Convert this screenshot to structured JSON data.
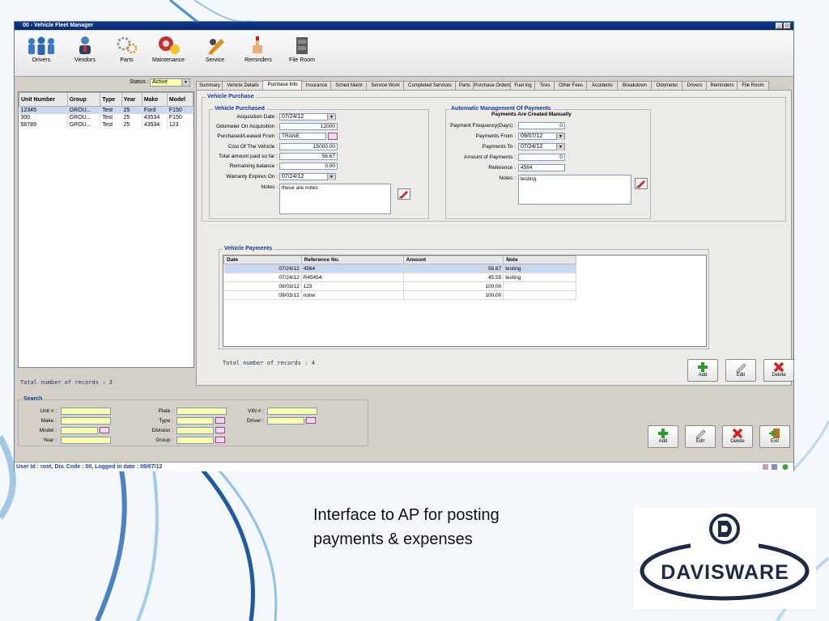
{
  "window": {
    "title": "00 - Vehicle Fleet Manager"
  },
  "toolbar": [
    {
      "label": "Drivers",
      "icon": "drivers-icon"
    },
    {
      "label": "Vendors",
      "icon": "vendors-icon"
    },
    {
      "label": "Parts",
      "icon": "parts-icon"
    },
    {
      "label": "Maintenance",
      "icon": "maintenance-icon"
    },
    {
      "label": "Service",
      "icon": "service-icon"
    },
    {
      "label": "Reminders",
      "icon": "reminders-icon"
    },
    {
      "label": "File Room",
      "icon": "file-room-icon"
    }
  ],
  "left": {
    "status_label": "Status :",
    "status_value": "Active",
    "columns": [
      "Unit Number",
      "Group",
      "Type",
      "Year",
      "Make",
      "Model"
    ],
    "rows": [
      [
        "12345",
        "GROU...",
        "Test",
        "25",
        "Ford",
        "F150"
      ],
      [
        "300",
        "GROU...",
        "Test",
        "25",
        "43534",
        "F150"
      ],
      [
        "56789",
        "GROU...",
        "Test",
        "25",
        "43534",
        "123"
      ]
    ],
    "total_records": "Total number of records : 3"
  },
  "tabs": [
    "Summary",
    "Vehicle Details",
    "Purchase Info",
    "Insurance",
    "Sched Maint",
    "Service Work",
    "Completed Services",
    "Parts",
    "Purchase Orders",
    "Fuel log",
    "Tires",
    "Other Fees",
    "Accidents",
    "Breakdown",
    "Odometer",
    "Drivers",
    "Reminders",
    "File Room"
  ],
  "active_tab": "Purchase Info",
  "purchase": {
    "outer_title": "Vehicle Purchase",
    "vp_title": "Vehicle Purchased",
    "acq_date_label": "Acquisition Date :",
    "acq_date": "07/24/12",
    "odometer_label": "Odometer On Acquisition :",
    "odometer": "12000",
    "purchased_from_label": "Purchased/Leased From :",
    "purchased_from": "TRANE",
    "cost_label": "Cost Of The Vehicle :",
    "cost": "15000.00",
    "paid_label": "Total amount paid so far :",
    "paid": "56.67",
    "remaining_label": "Remaining balance :",
    "remaining": "0.00",
    "warranty_label": "Warranty Expires On :",
    "warranty": "07/24/12",
    "notes_label": "Notes :",
    "notes": "these are notes"
  },
  "auto": {
    "title": "Automatic  Management Of Payments",
    "subtitle": "Payments Are Created Manually",
    "freq_label": "Payment Frequency(Days) :",
    "freq": "0",
    "from_label": "Payments From :",
    "from": "09/07/12",
    "to_label": "Payments To :",
    "to": "07/24/12",
    "amount_label": "Amount of Payments :",
    "amount": "0",
    "ref_label": "Reference :",
    "ref": "4564",
    "notes_label": "Notes :",
    "notes": "testing"
  },
  "payments": {
    "title": "Vehicle Payments",
    "columns": [
      "Date",
      "Reference No.",
      "Amount",
      "Note"
    ],
    "rows": [
      [
        "07/24/12",
        "4564",
        "56.67",
        "testing"
      ],
      [
        "07/24/12",
        "R45454",
        "45.55",
        "testing"
      ],
      [
        "09/03/12",
        "123",
        "100.00",
        ""
      ],
      [
        "09/03/12",
        "none",
        "100.00",
        ""
      ]
    ],
    "total_records": "Total number of records : 4"
  },
  "buttons": {
    "add": "Add",
    "edit": "Edit",
    "delete": "Delete",
    "exit": "Exit"
  },
  "search": {
    "title": "Search",
    "unit_label": "Unit # :",
    "make_label": "Make :",
    "model_label": "Model :",
    "year_label": "Year :",
    "plate_label": "Plate :",
    "type_label": "Type :",
    "division_label": "Division :",
    "group_label": "Group :",
    "vin_label": "VIN # :",
    "driver_label": "Driver :"
  },
  "statusbar": "User Id : root, Div. Code : 00, Logged in date : 09/07/12",
  "caption": "Interface to AP for posting payments & expenses",
  "logo_text": "DAVISWARE",
  "colors": {
    "title_bar": "#0c3a8c",
    "group_title": "#123a9a",
    "selection": "#c8d8f0",
    "search_field": "#ffffb0",
    "logo": "#1c2a44"
  }
}
